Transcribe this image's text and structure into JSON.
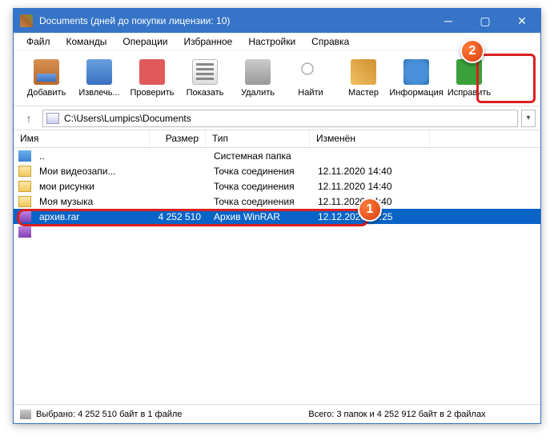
{
  "window": {
    "title": "Documents (дней до покупки лицензии: 10)"
  },
  "menu": {
    "file": "Файл",
    "commands": "Команды",
    "operations": "Операции",
    "favorites": "Избранное",
    "settings": "Настройки",
    "help": "Справка"
  },
  "toolbar": {
    "add": "Добавить",
    "extract": "Извлечь...",
    "test": "Проверить",
    "view": "Показать",
    "delete": "Удалить",
    "find": "Найти",
    "wizard": "Мастер",
    "info": "Информация",
    "repair": "Исправить"
  },
  "path": "C:\\Users\\Lumpics\\Documents",
  "columns": {
    "name": "Имя",
    "size": "Размер",
    "type": "Тип",
    "modified": "Изменён"
  },
  "rows": [
    {
      "name": "..",
      "size": "",
      "type": "Системная папка",
      "modified": "",
      "icon": "up"
    },
    {
      "name": "Мои видеозапи...",
      "size": "",
      "type": "Точка соединения",
      "modified": "12.11.2020 14:40",
      "icon": "folder"
    },
    {
      "name": "мои рисунки",
      "size": "",
      "type": "Точка соединения",
      "modified": "12.11.2020 14:40",
      "icon": "folder"
    },
    {
      "name": "Моя музыка",
      "size": "",
      "type": "Точка соединения",
      "modified": "12.11.2020 14:40",
      "icon": "folder"
    },
    {
      "name": "архив.rar",
      "size": "4 252 510",
      "type": "Архив WinRAR",
      "modified": "12.12.2020 17:25",
      "icon": "rar",
      "selected": true
    },
    {
      "name": "",
      "size": "",
      "type": "",
      "modified": "",
      "icon": "rar"
    }
  ],
  "status": {
    "left": "Выбрано: 4 252 510 байт в 1 файле",
    "right": "Всего: 3 папок и 4 252 912 байт в 2 файлах"
  },
  "badges": {
    "one": "1",
    "two": "2"
  }
}
